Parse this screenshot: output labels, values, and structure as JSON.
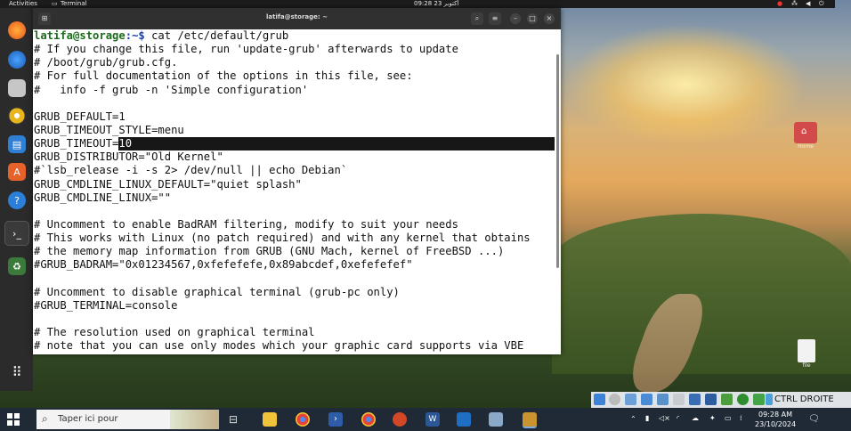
{
  "top_bar": {
    "activities": "Activities",
    "app_name": "Terminal",
    "clock": "09:28  23 أكتوبر"
  },
  "window": {
    "title": "latifa@storage: ~"
  },
  "terminal": {
    "prompt_user": "latifa@storage",
    "prompt_path": ":~$ ",
    "command": "cat /etc/default/grub",
    "lines_before": [
      "# If you change this file, run 'update-grub' afterwards to update",
      "# /boot/grub/grub.cfg.",
      "# For full documentation of the options in this file, see:",
      "#   info -f grub -n 'Simple configuration'",
      "",
      "GRUB_DEFAULT=1",
      "GRUB_TIMEOUT_STYLE=menu"
    ],
    "highlight_prefix": "GRUB_TIMEOUT=",
    "highlight_value": "10",
    "lines_after": [
      "GRUB_DISTRIBUTOR=\"Old Kernel\"",
      "#`lsb_release -i -s 2> /dev/null || echo Debian`",
      "GRUB_CMDLINE_LINUX_DEFAULT=\"quiet splash\"",
      "GRUB_CMDLINE_LINUX=\"\"",
      "",
      "# Uncomment to enable BadRAM filtering, modify to suit your needs",
      "# This works with Linux (no patch required) and with any kernel that obtains",
      "# the memory map information from GRUB (GNU Mach, kernel of FreeBSD ...)",
      "#GRUB_BADRAM=\"0x01234567,0xfefefefe,0x89abcdef,0xefefefef\"",
      "",
      "# Uncomment to disable graphical terminal (grub-pc only)",
      "#GRUB_TERMINAL=console",
      "",
      "# The resolution used on graphical terminal",
      "# note that you can use only modes which your graphic card supports via VBE"
    ]
  },
  "desktop": {
    "home_label": "Home",
    "file_label": "file"
  },
  "vbox_bar": {
    "host_key": "CTRL DROITE"
  },
  "taskbar": {
    "search_placeholder": "Taper ici pour",
    "time": "09:28 AM",
    "date": "23/10/2024"
  },
  "colors": {
    "prompt_user": "#1b6b1b",
    "prompt_path": "#1a3fa8",
    "selection": "#171717",
    "taskbar": "#1f2a36"
  }
}
